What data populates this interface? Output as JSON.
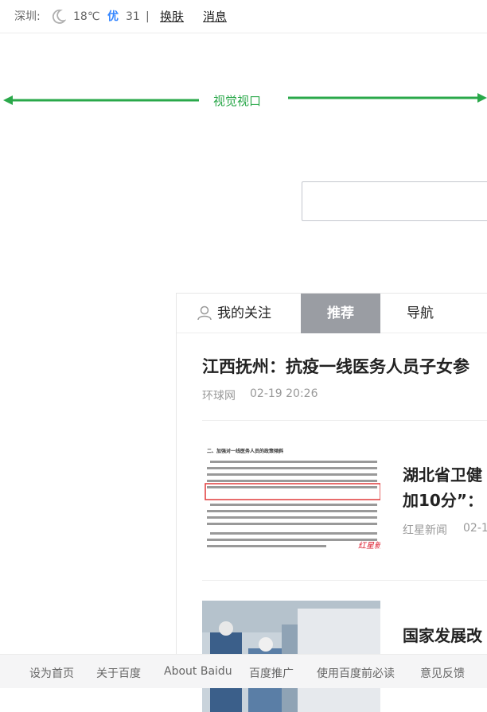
{
  "topbar": {
    "city": "深圳:",
    "temperature": "18℃",
    "air_quality_label": "优",
    "air_quality_value": "31",
    "divider": "|",
    "skin_label": "换肤",
    "messages_label": "消息"
  },
  "viewport_annotation": {
    "label": "视觉视口",
    "color": "#2aa84a"
  },
  "search": {
    "placeholder": ""
  },
  "feed": {
    "tabs": [
      {
        "label": "我的关注",
        "icon": "user-icon"
      },
      {
        "label": "推荐",
        "active": true
      },
      {
        "label": "导航"
      }
    ],
    "articles": [
      {
        "title": "江西抚州：抗疫一线医务人员子女参",
        "source": "环球网",
        "time": "02-19 20:26"
      },
      {
        "title_line1": "湖北省卫健",
        "title_line2": "加10分”：",
        "source": "红星新闻",
        "time": "02-1"
      },
      {
        "title_line1": "国家发展改"
      }
    ],
    "thumb1": {
      "heading": "二、加强对一线医务人员的政策倾斜",
      "watermark": "红星新闻"
    }
  },
  "footer": {
    "links": [
      "设为首页",
      "关于百度",
      "About Baidu",
      "百度推广",
      "使用百度前必读",
      "意见反馈"
    ]
  },
  "colors": {
    "accent": "#3385ff",
    "tab_active_bg": "#9a9da3",
    "annotation_green": "#2aa84a"
  }
}
